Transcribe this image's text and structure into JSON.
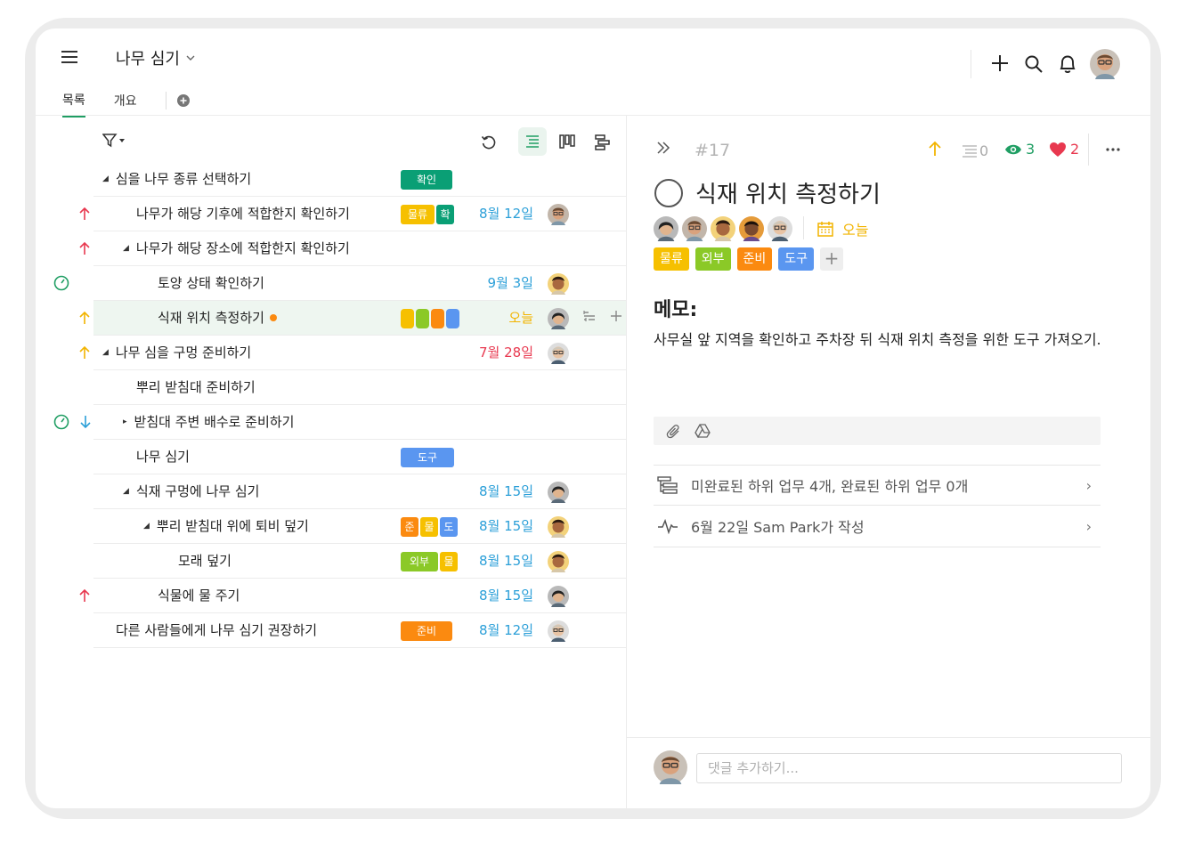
{
  "header": {
    "project_title": "나무 심기"
  },
  "tabs": [
    {
      "label": "목록"
    },
    {
      "label": "개요"
    }
  ],
  "colors": {
    "green": "#1f9e63",
    "yellow": "#f6c000",
    "teal": "#0a9f75",
    "orange": "#fb8a10",
    "blue": "#5a96f0",
    "lime": "#8bc927",
    "red": "#e8384f",
    "date_blue": "#2b9fd8",
    "date_red": "#e8384f",
    "date_yellow": "#f2b400"
  },
  "tasks": [
    {
      "name": "심을 나무 종류 선택하기",
      "tags": [
        "확인"
      ],
      "date": "",
      "indent": 0,
      "caret": "down",
      "lead": ""
    },
    {
      "name": "나무가 해당 기후에 적합한지 확인하기",
      "tags": [
        "물류",
        "확"
      ],
      "date": "8월 12일",
      "indent": 1,
      "caret": "",
      "lead": "up-red"
    },
    {
      "name": "나무가 해당 장소에 적합한지 확인하기",
      "tags": [],
      "date": "",
      "indent": 1,
      "caret": "down",
      "lead": "up-red"
    },
    {
      "name": "토양 상태 확인하기",
      "tags": [],
      "date": "9월 3일",
      "indent": 2,
      "caret": "",
      "lead": "timer"
    },
    {
      "name": "식재 위치 측정하기",
      "tags": [],
      "date": "오늘",
      "indent": 2,
      "caret": "",
      "lead": "up-yellow"
    },
    {
      "name": "나무 심을 구멍 준비하기",
      "tags": [],
      "date": "7월 28일",
      "indent": 0,
      "caret": "down",
      "lead": "up-yellow"
    },
    {
      "name": "뿌리 받침대 준비하기",
      "tags": [],
      "date": "",
      "indent": 1,
      "caret": "",
      "lead": ""
    },
    {
      "name": "받침대 주변 배수로 준비하기",
      "tags": [],
      "date": "",
      "indent": 1,
      "caret": "right",
      "lead": "timer-down"
    },
    {
      "name": "나무 심기",
      "tags": [
        "도구"
      ],
      "date": "",
      "indent": 1,
      "caret": "",
      "lead": ""
    },
    {
      "name": "식재 구멍에 나무 심기",
      "tags": [],
      "date": "8월 15일",
      "indent": 1,
      "caret": "down",
      "lead": ""
    },
    {
      "name": "뿌리 받침대 위에 퇴비 덮기",
      "tags": [
        "준",
        "물",
        "도"
      ],
      "date": "8월 15일",
      "indent": 2,
      "caret": "down",
      "lead": ""
    },
    {
      "name": "모래 덮기",
      "tags": [
        "외부",
        "물"
      ],
      "date": "8월 15일",
      "indent": 3,
      "caret": "",
      "lead": ""
    },
    {
      "name": "식물에 물 주기",
      "tags": [],
      "date": "8월 15일",
      "indent": 2,
      "caret": "",
      "lead": "up-red"
    },
    {
      "name": "다른 사람들에게 나무 심기 권장하기",
      "tags": [
        "준비"
      ],
      "date": "8월 12일",
      "indent": 0,
      "caret": "",
      "lead": ""
    }
  ],
  "detail": {
    "task_id": "#17",
    "subtask_count": "0",
    "watchers": "3",
    "likes": "2",
    "title": "식재 위치 측정하기",
    "due": "오늘",
    "tags": [
      "물류",
      "외부",
      "준비",
      "도구"
    ],
    "tag_add": "+",
    "memo_heading": "메모:",
    "memo": "사무실 앞 지역을 확인하고 주차장 뒤 식재 위치 측정을 위한 도구 가져오기.",
    "subtasks_summary": "미완료된 하위 업무 4개, 완료된 하위 업무 0개",
    "activity": "6월 22일 Sam Park가 작성",
    "comment_placeholder": "댓글 추가하기..."
  }
}
